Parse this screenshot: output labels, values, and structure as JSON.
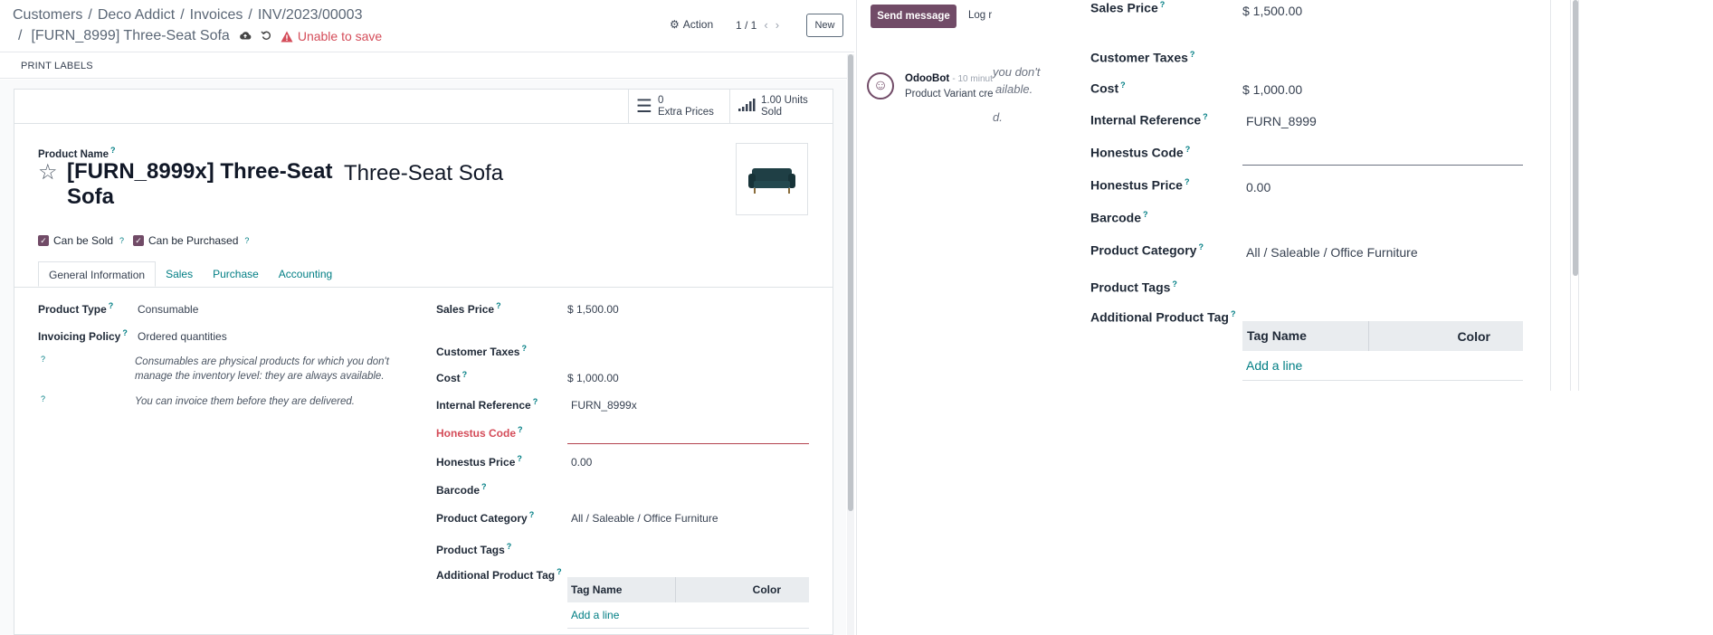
{
  "breadcrumb": {
    "items": [
      "Customers",
      "Deco Addict",
      "Invoices",
      "INV/2023/00003"
    ],
    "current": "[FURN_8999] Three-Seat Sofa",
    "separator": "/",
    "warning": "Unable to save"
  },
  "toolbar": {
    "action_label": "Action",
    "pager": "1 / 1",
    "new_label": "New",
    "print_labels": "PRINT LABELS"
  },
  "stat_buttons": [
    {
      "value": "0",
      "label": "Extra Prices",
      "icon": "list-icon"
    },
    {
      "value": "1.00 Units",
      "label": "Sold",
      "icon": "signal-bars-icon"
    }
  ],
  "product": {
    "name_label": "Product Name",
    "name_value": "[FURN_8999x] Three-Seat Sofa",
    "name_display": "Three-Seat Sofa",
    "can_be_sold": "Can be Sold",
    "can_be_purchased": "Can be Purchased"
  },
  "tabs": [
    "General Information",
    "Sales",
    "Purchase",
    "Accounting"
  ],
  "left_fields": {
    "product_type_label": "Product Type",
    "product_type_value": "Consumable",
    "invoicing_policy_label": "Invoicing Policy",
    "invoicing_policy_value": "Ordered quantities",
    "help1": "Consumables are physical products for which you don't manage the inventory level: they are always available.",
    "help2": "You can invoice them before they are delivered."
  },
  "right_fields": {
    "sales_price_label": "Sales Price",
    "sales_price_value": "$ 1,500.00",
    "customer_taxes_label": "Customer Taxes",
    "cost_label": "Cost",
    "cost_value": "$ 1,000.00",
    "internal_reference_label": "Internal Reference",
    "internal_reference_value": "FURN_8999x",
    "honestus_code_label": "Honestus Code",
    "honestus_price_label": "Honestus Price",
    "honestus_price_value": "0.00",
    "barcode_label": "Barcode",
    "product_category_label": "Product Category",
    "product_category_value": "All / Saleable / Office Furniture",
    "product_tags_label": "Product Tags",
    "additional_tag_label": "Additional Product Tag",
    "tag_col_name": "Tag Name",
    "tag_col_color": "Color",
    "add_line": "Add a line"
  },
  "chatter": {
    "send_message": "Send message",
    "log_note": "Log r",
    "author": "OdooBot",
    "time": "- 10 minut",
    "message": "Product Variant cre",
    "ghost_line1": "you don't",
    "ghost_line2": "ailable.",
    "ghost_line3": "d."
  },
  "zoomed_fields": {
    "sales_price_label": "Sales Price",
    "sales_price_value": "$ 1,500.00",
    "customer_taxes_label": "Customer Taxes",
    "cost_label": "Cost",
    "cost_value": "$ 1,000.00",
    "internal_reference_label": "Internal Reference",
    "internal_reference_value": "FURN_8999",
    "honestus_code_label": "Honestus Code",
    "honestus_price_label": "Honestus Price",
    "honestus_price_value": "0.00",
    "barcode_label": "Barcode",
    "product_category_label": "Product Category",
    "product_category_value": "All / Saleable / Office Furniture",
    "product_tags_label": "Product Tags",
    "additional_tag_label": "Additional Product Tag",
    "tag_col_name": "Tag Name",
    "tag_col_color": "Color",
    "add_line": "Add a line"
  },
  "colors": {
    "brand": "#714b67",
    "link": "#017e84",
    "danger": "#d44c59"
  }
}
